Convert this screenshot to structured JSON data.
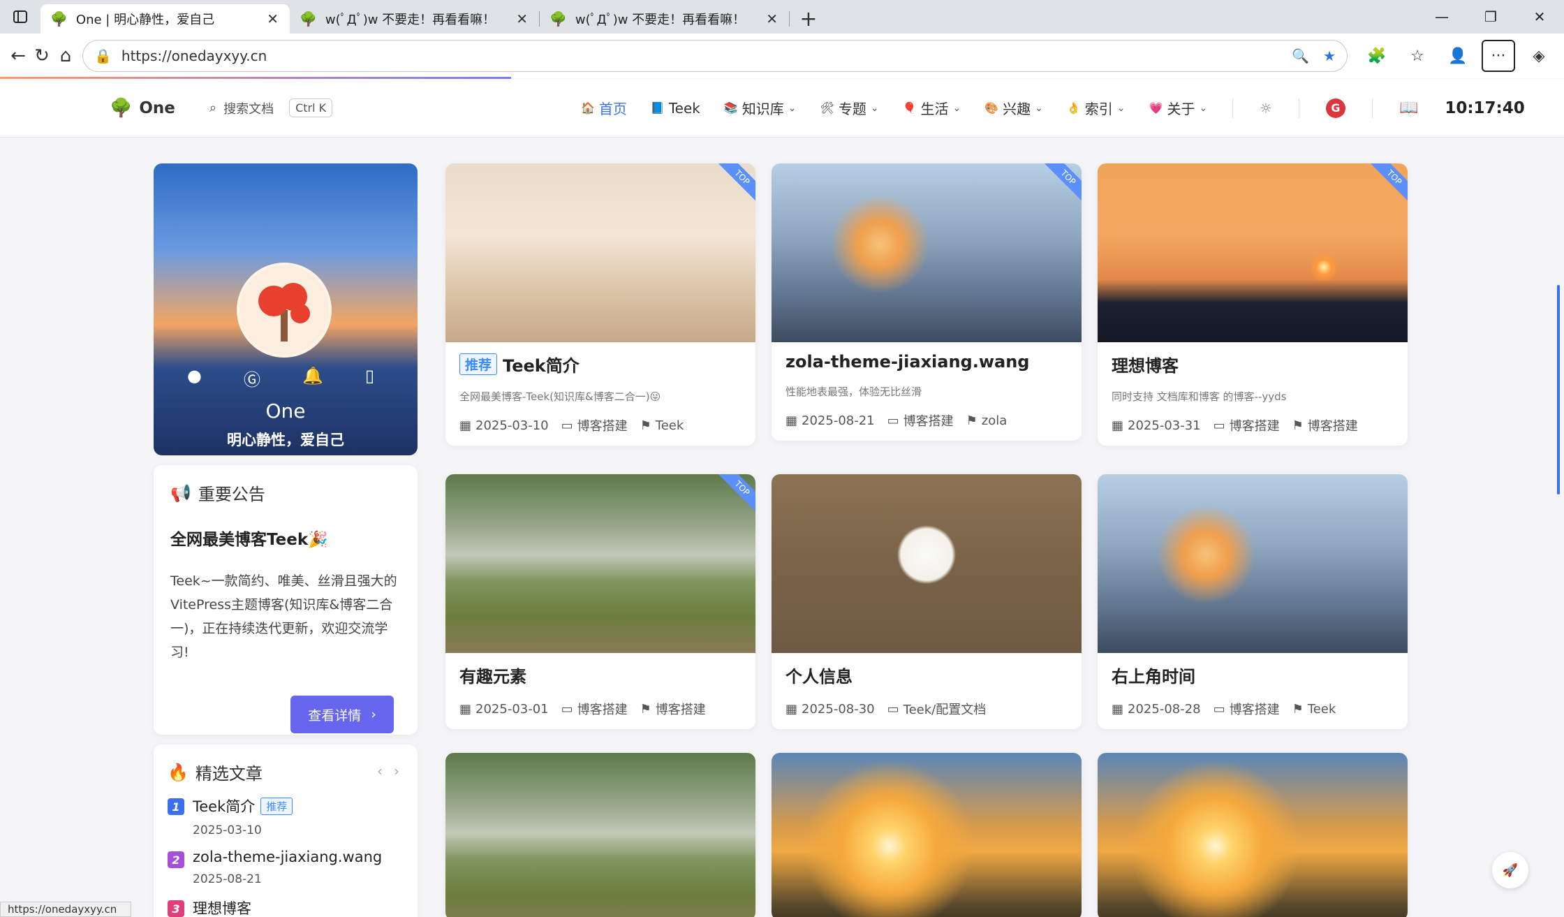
{
  "tabs": [
    {
      "title": "One | 明心静性，爱自己",
      "active": true
    },
    {
      "title": "w(ﾟДﾟ)w 不要走！再看看嘛！",
      "active": false
    },
    {
      "title": "w(ﾟДﾟ)w 不要走！再看看嘛！",
      "active": false
    }
  ],
  "address": {
    "url": "https://onedayxyy.cn"
  },
  "header": {
    "logo_text": "One",
    "search_label": "搜索文档",
    "search_kbd": "Ctrl K",
    "nav": [
      {
        "label": "首页",
        "icon": "home-icon",
        "active": true,
        "dropdown": false
      },
      {
        "label": "Teek",
        "icon": "book-icon",
        "active": false,
        "dropdown": false
      },
      {
        "label": "知识库",
        "icon": "books-icon",
        "active": false,
        "dropdown": true
      },
      {
        "label": "专题",
        "icon": "tools-icon",
        "active": false,
        "dropdown": true
      },
      {
        "label": "生活",
        "icon": "balloon-icon",
        "active": false,
        "dropdown": true
      },
      {
        "label": "兴趣",
        "icon": "palette-icon",
        "active": false,
        "dropdown": true
      },
      {
        "label": "索引",
        "icon": "index-icon",
        "active": false,
        "dropdown": true
      },
      {
        "label": "关于",
        "icon": "heart-icon",
        "active": false,
        "dropdown": true
      }
    ],
    "clock": "10:17:40"
  },
  "profile": {
    "name": "One",
    "motto": "明心静性，爱自己"
  },
  "notice": {
    "heading": "重要公告",
    "title": "全网最美博客Teek🎉",
    "body": "Teek~一款简约、唯美、丝滑且强大的VitePress主题博客(知识库&博客二合一)，正在持续迭代更新，欢迎交流学习!",
    "button": "查看详情"
  },
  "featured": {
    "heading": "精选文章",
    "items": [
      {
        "num": "1",
        "title": "Teek简介",
        "badge": "推荐",
        "date": "2025-03-10",
        "color": "#3b6ff0"
      },
      {
        "num": "2",
        "title": "zola-theme-jiaxiang.wang",
        "badge": "",
        "date": "2025-08-21",
        "color": "#a64fd8"
      },
      {
        "num": "3",
        "title": "理想博客",
        "badge": "",
        "date": "",
        "color": "#e0407a"
      }
    ]
  },
  "posts": [
    {
      "title": "Teek简介",
      "badge": "推荐",
      "desc": "全网最美博客-Teek(知识库&博客二合一)😜",
      "date": "2025-03-10",
      "category": "博客搭建",
      "tag": "Teek",
      "top": "TOP",
      "img": "img-room"
    },
    {
      "title": "zola-theme-jiaxiang.wang",
      "badge": "",
      "desc": "性能地表最强，体验无比丝滑",
      "date": "2025-08-21",
      "category": "博客搭建",
      "tag": "zola",
      "top": "TOP",
      "img": "img-sunset"
    },
    {
      "title": "理想博客",
      "badge": "",
      "desc": "同时支持 文档库和博客 的博客--yyds",
      "date": "2025-03-31",
      "category": "博客搭建",
      "tag": "博客搭建",
      "top": "TOP",
      "img": "img-temple"
    },
    {
      "title": "有趣元素",
      "badge": "",
      "desc": "",
      "date": "2025-03-01",
      "category": "博客搭建",
      "tag": "博客搭建",
      "top": "TOP",
      "img": "img-goat"
    },
    {
      "title": "个人信息",
      "badge": "",
      "desc": "",
      "date": "2025-08-30",
      "category": "Teek/配置文档",
      "tag": "",
      "top": "",
      "img": "img-dog"
    },
    {
      "title": "右上角时间",
      "badge": "",
      "desc": "",
      "date": "2025-08-28",
      "category": "博客搭建",
      "tag": "Teek",
      "top": "",
      "img": "img-sunset"
    },
    {
      "title": "",
      "badge": "",
      "desc": "",
      "date": "",
      "category": "",
      "tag": "",
      "top": "",
      "img": "img-goat"
    },
    {
      "title": "",
      "badge": "",
      "desc": "",
      "date": "",
      "category": "",
      "tag": "",
      "top": "",
      "img": "img-trees"
    },
    {
      "title": "",
      "badge": "",
      "desc": "",
      "date": "",
      "category": "",
      "tag": "",
      "top": "",
      "img": "img-trees"
    }
  ],
  "status_url": "https://onedayxyy.cn"
}
